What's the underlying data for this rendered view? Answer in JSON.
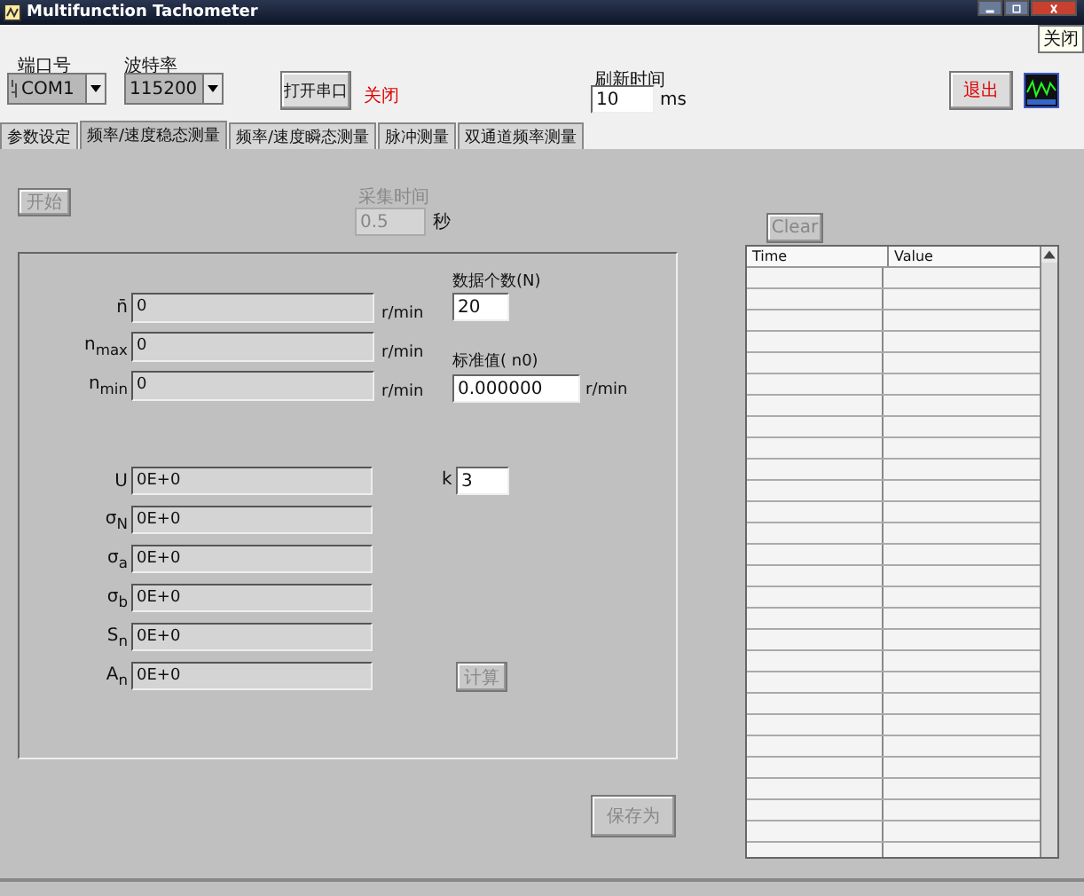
{
  "window": {
    "title": "Multifunction Tachometer",
    "tooltip": "关闭"
  },
  "serial": {
    "port_label": "端口号",
    "port": "COM1",
    "baud_label": "波特率",
    "baud": "115200",
    "open_button": "打开串口",
    "status": "关闭"
  },
  "refresh": {
    "label": "刷新时间",
    "value": "10",
    "unit": "ms"
  },
  "exit_button": "退出",
  "tabs": [
    {
      "label": "参数设定",
      "selected": false
    },
    {
      "label": "频率/速度稳态测量",
      "selected": true
    },
    {
      "label": "频率/速度瞬态测量",
      "selected": false
    },
    {
      "label": "脉冲测量",
      "selected": false
    },
    {
      "label": "双通道频率测量",
      "selected": false
    }
  ],
  "start_button": {
    "label": "开始",
    "disabled": true
  },
  "sample_time": {
    "label": "采集时间",
    "value": "0.5",
    "unit": "秒",
    "disabled": true
  },
  "speed_rows": [
    {
      "label": "n̄",
      "value": "0",
      "unit": "r/min"
    },
    {
      "label": "n$_{max}$",
      "value": "0",
      "unit": "r/min"
    },
    {
      "label": "n$_{min}$",
      "value": "0",
      "unit": "r/min"
    }
  ],
  "count": {
    "label": "数据个数(N)",
    "value": "20"
  },
  "standard": {
    "label": "标准值( n0)",
    "value": "0.000000",
    "unit": "r/min"
  },
  "stat_rows": [
    {
      "label": "U",
      "value": "0E+0"
    },
    {
      "label": "σ$_{N}$",
      "value": "0E+0"
    },
    {
      "label": "σ$_{a}$",
      "value": "0E+0"
    },
    {
      "label": "σ$_{b}$",
      "value": "0E+0"
    },
    {
      "label": "S$_{n}$",
      "value": "0E+0"
    },
    {
      "label": "A$_{n}$",
      "value": "0E+0"
    }
  ],
  "k": {
    "label": "k",
    "value": "3"
  },
  "calc_button": {
    "label": "计算",
    "disabled": true
  },
  "save_button": {
    "label": "保存为",
    "disabled": true
  },
  "clear_button": {
    "label": "Clear",
    "disabled": true
  },
  "table": {
    "columns": [
      "Time",
      "Value"
    ]
  }
}
